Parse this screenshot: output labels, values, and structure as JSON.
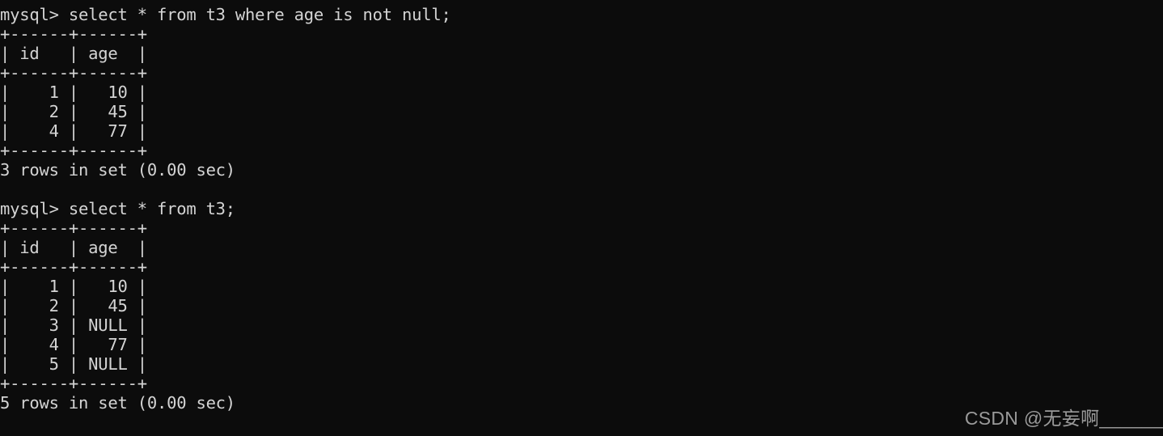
{
  "terminal": {
    "background_color": "#0c0c0c",
    "text_color": "#d4d4d4",
    "prompt": "mysql>",
    "lines": [
      "mysql> select * from t3 where age is not null;",
      "+------+------+",
      "| id   | age  |",
      "+------+------+",
      "|    1 |   10 |",
      "|    2 |   45 |",
      "|    4 |   77 |",
      "+------+------+",
      "3 rows in set (0.00 sec)",
      "",
      "mysql> select * from t3;",
      "+------+------+",
      "| id   | age  |",
      "+------+------+",
      "|    1 |   10 |",
      "|    2 |   45 |",
      "|    3 | NULL |",
      "|    4 |   77 |",
      "|    5 | NULL |",
      "+------+------+",
      "5 rows in set (0.00 sec)"
    ],
    "queries": [
      {
        "command": "select * from t3 where age is not null;",
        "columns": [
          "id",
          "age"
        ],
        "rows": [
          [
            "1",
            "10"
          ],
          [
            "2",
            "45"
          ],
          [
            "4",
            "77"
          ]
        ],
        "status": "3 rows in set (0.00 sec)"
      },
      {
        "command": "select * from t3;",
        "columns": [
          "id",
          "age"
        ],
        "rows": [
          [
            "1",
            "10"
          ],
          [
            "2",
            "45"
          ],
          [
            "3",
            "NULL"
          ],
          [
            "4",
            "77"
          ],
          [
            "5",
            "NULL"
          ]
        ],
        "status": "5 rows in set (0.00 sec)"
      }
    ]
  },
  "watermark": {
    "text": "CSDN @无妄啊______",
    "color": "#9a9a9a"
  }
}
